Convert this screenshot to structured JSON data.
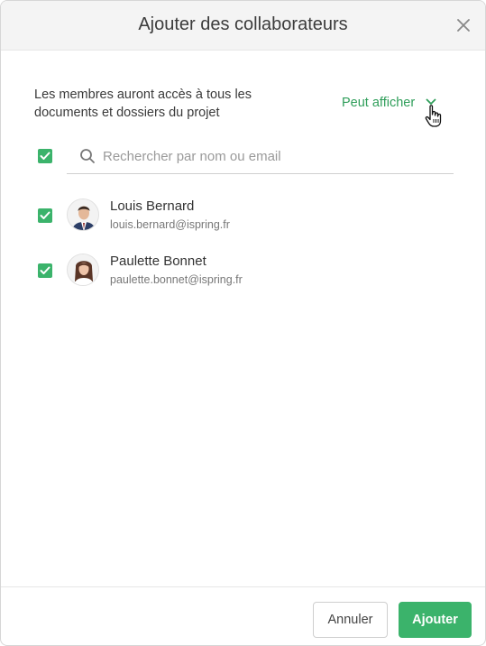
{
  "dialog": {
    "title": "Ajouter des collaborateurs",
    "description": "Les membres auront accès à tous les documents et dossiers du projet",
    "permission": "Peut afficher",
    "search": {
      "placeholder": "Rechercher par nom ou email",
      "value": ""
    },
    "select_all_checked": true,
    "users": [
      {
        "name": "Louis Bernard",
        "email": "louis.bernard@ispring.fr",
        "checked": true
      },
      {
        "name": "Paulette Bonnet",
        "email": "paulette.bonnet@ispring.fr",
        "checked": true
      }
    ],
    "buttons": {
      "cancel": "Annuler",
      "add": "Ajouter"
    }
  },
  "colors": {
    "accent": "#3bb36b",
    "link_green": "#2f9e5a",
    "header_bg": "#f4f4f4"
  },
  "icons": [
    "close-icon",
    "chevron-down-icon",
    "search-icon",
    "check-icon",
    "hand-cursor-icon"
  ]
}
